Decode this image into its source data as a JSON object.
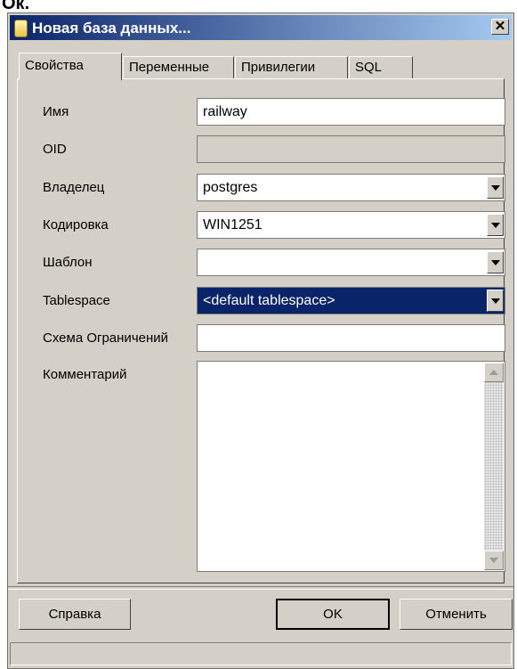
{
  "overlay_text": "Ок.",
  "window": {
    "title": "Новая база данных...",
    "close_label": "✕"
  },
  "tabs": [
    "Свойства",
    "Переменные",
    "Привилегии",
    "SQL"
  ],
  "form": {
    "name": {
      "label": "Имя",
      "value": "railway"
    },
    "oid": {
      "label": "OID",
      "value": ""
    },
    "owner": {
      "label": "Владелец",
      "value": "postgres"
    },
    "encoding": {
      "label": "Кодировка",
      "value": "WIN1251"
    },
    "template": {
      "label": "Шаблон",
      "value": ""
    },
    "tablespace": {
      "label": "Tablespace",
      "value": "<default tablespace>"
    },
    "schema_restriction": {
      "label": "Схема Ограничений",
      "value": ""
    },
    "comment": {
      "label": "Комментарий",
      "value": ""
    }
  },
  "buttons": {
    "help": "Справка",
    "ok": "OK",
    "cancel": "Отменить"
  },
  "icons": {
    "title": "database-icon",
    "close": "close-icon",
    "dropdown": "chevron-down-icon"
  },
  "colors": {
    "titlebar_start": "#0a246a",
    "titlebar_end": "#a6caf0",
    "selection": "#0a246a",
    "face": "#d4d0c8"
  }
}
